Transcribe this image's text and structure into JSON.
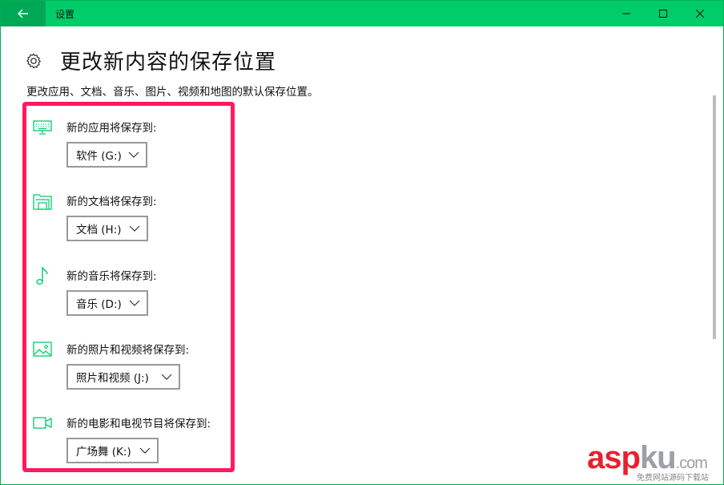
{
  "window": {
    "title": "设置",
    "colors": {
      "titlebar": "#00cc6a",
      "back_button": "#00a855",
      "accent_icon": "#00cc6a",
      "highlight": "#ff1a5e"
    }
  },
  "controls": {
    "back_icon": "arrow-left-icon",
    "minimize_icon": "minimize-icon",
    "maximize_icon": "maximize-icon",
    "close_icon": "close-icon"
  },
  "page": {
    "title": "更改新内容的保存位置",
    "description": "更改应用、文档、音乐、图片、视频和地图的默认保存位置。"
  },
  "settings": [
    {
      "icon": "keyboard-icon",
      "label": "新的应用将保存到:",
      "value": "软件 (G:)"
    },
    {
      "icon": "folder-icon",
      "label": "新的文档将保存到:",
      "value": "文档 (H:)"
    },
    {
      "icon": "music-note-icon",
      "label": "新的音乐将保存到:",
      "value": "音乐 (D:)"
    },
    {
      "icon": "image-icon",
      "label": "新的照片和视频将保存到:",
      "value": "照片和视频 (J:)"
    },
    {
      "icon": "video-camera-icon",
      "label": "新的电影和电视节目将保存到:",
      "value": "广场舞 (K:)"
    }
  ],
  "watermark": {
    "brand_a": "asp",
    "brand_b": "ku",
    "brand_c": ".com",
    "tagline": "免费网站源码下载站"
  }
}
